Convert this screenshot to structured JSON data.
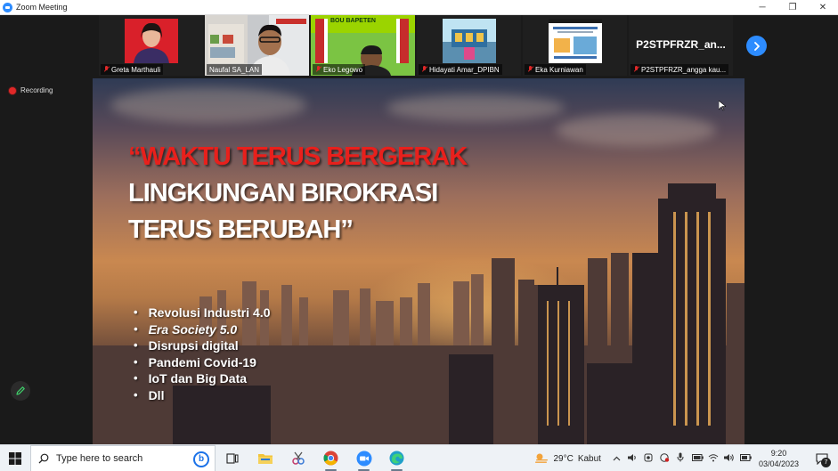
{
  "window": {
    "title": "Zoom Meeting",
    "controls": {
      "minimize": "─",
      "restore": "❐",
      "close": "✕"
    }
  },
  "participants": [
    {
      "name": "Greta Marthauli",
      "muted": true
    },
    {
      "name": "Naufal SA_LAN",
      "muted": false,
      "active_speaker": true
    },
    {
      "name": "Eko Legowo",
      "muted": true,
      "banner_text": "BOU BAPETEN"
    },
    {
      "name": "Hidayati Amar_DPIBN",
      "muted": true
    },
    {
      "name": "Eka Kurniawan",
      "muted": true
    },
    {
      "name": "P2STPFRZR_angga kau...",
      "muted": true,
      "display_text": "P2STPFRZR_an..."
    }
  ],
  "recording_label": "Recording",
  "slide": {
    "quote_line1": "“WAKTU TERUS BERGERAK",
    "quote_line2": "LINGKUNGAN BIROKRASI",
    "quote_line3": "TERUS BERUBAH”",
    "bullets": [
      {
        "text": "Revolusi Industri 4.0",
        "italic": false
      },
      {
        "text": "Era Society 5.0",
        "italic": true
      },
      {
        "text": "Disrupsi digital",
        "italic": false
      },
      {
        "text": "Pandemi Covid-19",
        "italic": false
      },
      {
        "text": "IoT dan Big Data",
        "italic": false
      },
      {
        "text": "Dll",
        "italic": false
      }
    ],
    "accent_red": "#e8201c"
  },
  "taskbar": {
    "search_placeholder": "Type here to search",
    "bing_label": "b",
    "weather": {
      "temp": "29°C",
      "condition": "Kabut"
    },
    "clock": {
      "time": "9:20",
      "date": "03/04/2023"
    },
    "notifications": "7"
  },
  "colors": {
    "zoom_blue": "#2d8cff",
    "active_speaker": "#9bd400",
    "recording": "#e02828"
  }
}
